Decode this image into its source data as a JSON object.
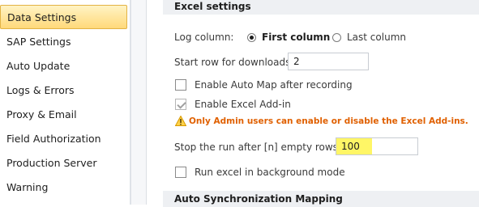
{
  "sidebar": {
    "items": [
      {
        "label": "Data Settings",
        "selected": true
      },
      {
        "label": "SAP Settings"
      },
      {
        "label": "Auto Update"
      },
      {
        "label": "Logs & Errors"
      },
      {
        "label": "Proxy & Email"
      },
      {
        "label": "Field Authorization"
      },
      {
        "label": "Production Server Warning"
      }
    ]
  },
  "excel_settings": {
    "header": "Excel settings",
    "log_column": {
      "label": "Log column:",
      "options": [
        {
          "label": "First column",
          "checked": true
        },
        {
          "label": "Last column",
          "checked": false
        }
      ]
    },
    "start_row": {
      "label": "Start row for downloads:",
      "value": "2"
    },
    "enable_auto_map": {
      "label": "Enable Auto Map after recording",
      "checked": false
    },
    "enable_excel_addin": {
      "label": "Enable Excel Add-in",
      "checked": true,
      "disabled": true
    },
    "warning": {
      "text": "Only Admin users can enable or disable the Excel Add-ins.",
      "icon": "warning-icon",
      "color": "#e06000"
    },
    "stop_run": {
      "label": "Stop the run after [n] empty rows:",
      "value": "100",
      "highlight_color": "#fff666"
    },
    "run_background": {
      "label": "Run excel in background mode",
      "checked": false
    }
  },
  "auto_sync": {
    "header": "Auto Synchronization Mapping"
  },
  "colors": {
    "selected_bg": "#ffd97a",
    "header_bg": "#eef0f3"
  }
}
